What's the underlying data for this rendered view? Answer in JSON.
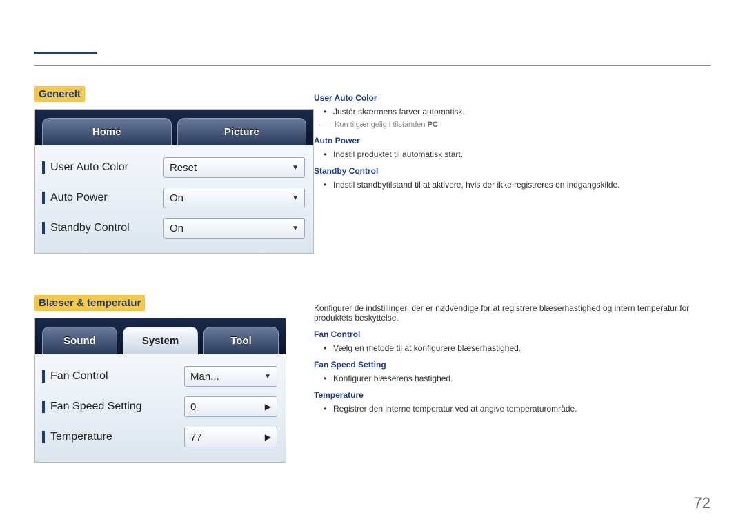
{
  "page_number": "72",
  "section1": {
    "heading": "Generelt",
    "tabs": {
      "home": "Home",
      "picture": "Picture"
    },
    "rows": [
      {
        "label": "User Auto Color",
        "value": "Reset",
        "control": "dropdown"
      },
      {
        "label": "Auto Power",
        "value": "On",
        "control": "dropdown"
      },
      {
        "label": "Standby Control",
        "value": "On",
        "control": "dropdown"
      }
    ],
    "desc": {
      "uac_title": "User Auto Color",
      "uac_bullet": "Justér skærmens farver automatisk.",
      "uac_note_pre": "Kun tilgængelig i tilstanden ",
      "uac_note_mode": "PC",
      "ap_title": "Auto Power",
      "ap_bullet": "Indstil produktet til automatisk start.",
      "sc_title": "Standby Control",
      "sc_bullet": "Indstil standbytilstand til at aktivere, hvis der ikke registreres en indgangskilde."
    }
  },
  "section2": {
    "heading": "Blæser & temperatur",
    "tabs": {
      "sound": "Sound",
      "system": "System",
      "tool": "Tool"
    },
    "rows": [
      {
        "label": "Fan Control",
        "value": "Man...",
        "control": "dropdown"
      },
      {
        "label": "Fan Speed Setting",
        "value": "0",
        "control": "stepper"
      },
      {
        "label": "Temperature",
        "value": "77",
        "control": "stepper"
      }
    ],
    "desc": {
      "intro": "Konfigurer de indstillinger, der er nødvendige for at registrere blæserhastighed og intern temperatur for produktets beskyttelse.",
      "fc_title": "Fan Control",
      "fc_bullet": "Vælg en metode til at konfigurere blæserhastighed.",
      "fss_title": "Fan Speed Setting",
      "fss_bullet": "Konfigurer blæserens hastighed.",
      "t_title": "Temperature",
      "t_bullet": "Registrer den interne temperatur ved at angive temperaturområde."
    }
  }
}
